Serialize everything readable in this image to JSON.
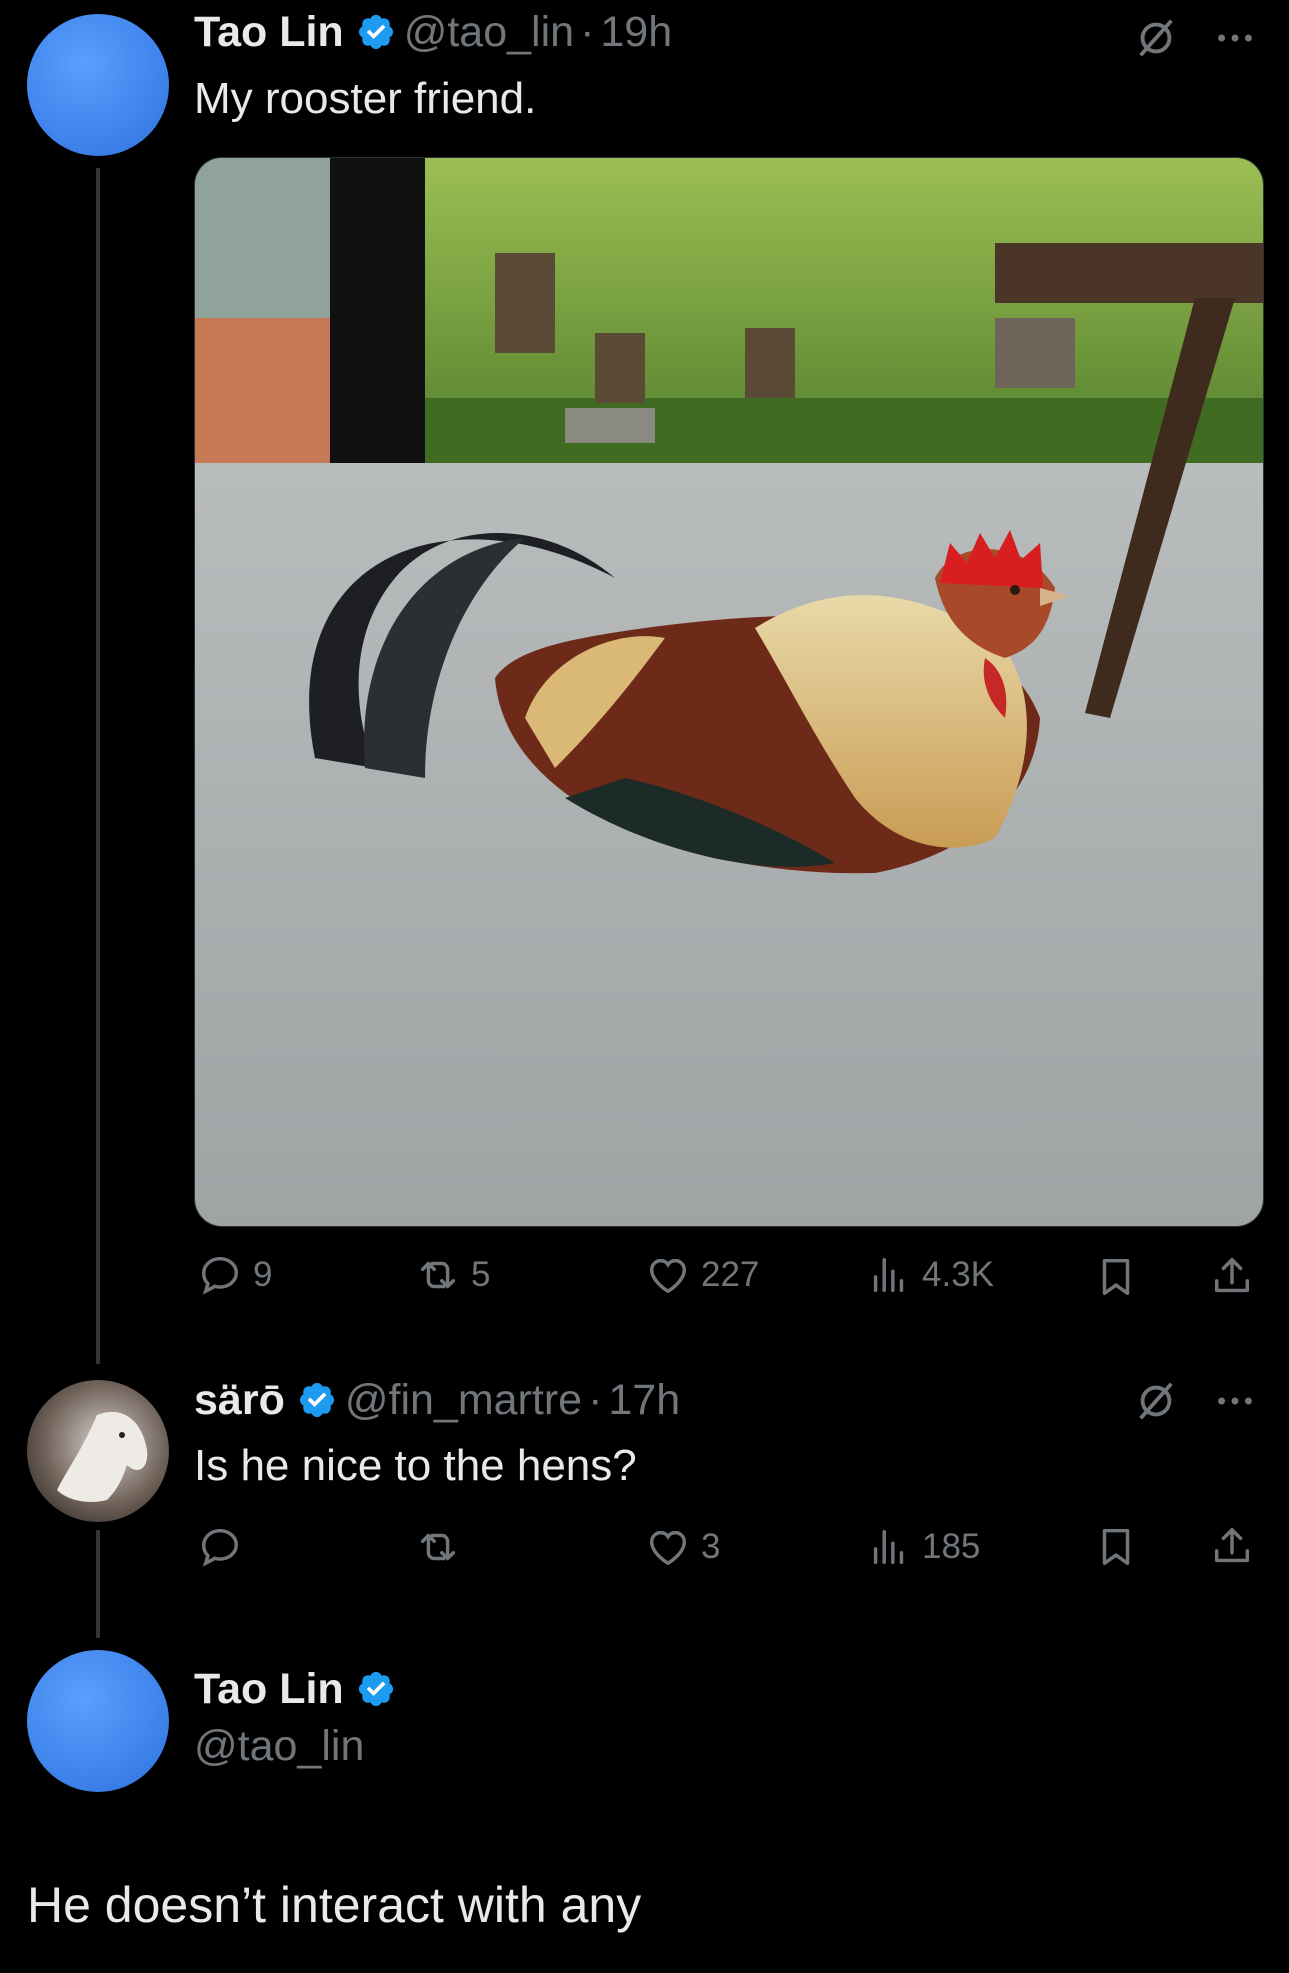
{
  "tweets": [
    {
      "name": "Tao Lin",
      "handle": "@tao_lin",
      "sep": "·",
      "time": "19h",
      "text": "My rooster friend.",
      "stats": {
        "replies": "9",
        "reposts": "5",
        "likes": "227",
        "views": "4.3K"
      }
    },
    {
      "name": "särō",
      "handle": "@fin_martre",
      "sep": "·",
      "time": "17h",
      "text": "Is he nice to the hens?",
      "stats": {
        "replies": "",
        "reposts": "",
        "likes": "3",
        "views": "185"
      }
    },
    {
      "name": "Tao Lin",
      "handle": "@tao_lin",
      "text": "He doesn’t interact with any"
    }
  ],
  "colors": {
    "accent": "#1d9bf0",
    "muted": "#71767b",
    "text": "#e7e9ea",
    "background": "#000000"
  },
  "icons": [
    "verified-badge-icon",
    "grok-icon",
    "more-icon",
    "reply-icon",
    "repost-icon",
    "like-icon",
    "views-icon",
    "bookmark-icon",
    "share-icon"
  ]
}
